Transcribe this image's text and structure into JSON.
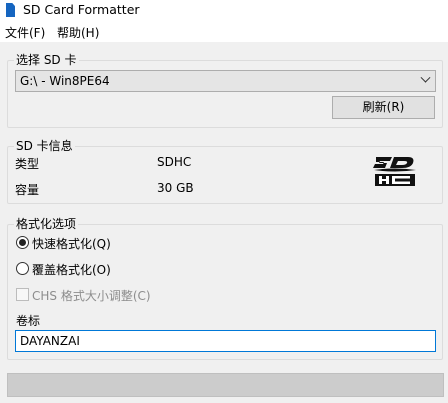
{
  "window": {
    "title": "SD Card Formatter"
  },
  "menu": {
    "items": [
      {
        "label": "文件(F)"
      },
      {
        "label": "帮助(H)"
      }
    ]
  },
  "select_card": {
    "group_title": "选择 SD 卡",
    "selected_value": "G:\\ - Win8PE64",
    "refresh_label": "刷新(R)"
  },
  "card_info": {
    "group_title": "SD 卡信息",
    "type_label": "类型",
    "type_value": "SDHC",
    "capacity_label": "容量",
    "capacity_value": "30 GB",
    "logo_text": "SD HC"
  },
  "format_options": {
    "group_title": "格式化选项",
    "quick_label": "快速格式化(Q)",
    "quick_checked": true,
    "overwrite_label": "覆盖格式化(O)",
    "overwrite_checked": false,
    "chs_label": "CHS 格式大小调整(C)",
    "chs_checked": false,
    "chs_enabled": false,
    "volume_label_title": "卷标",
    "volume_label_value": "DAYANZAI"
  },
  "format_button": {
    "label": ""
  }
}
